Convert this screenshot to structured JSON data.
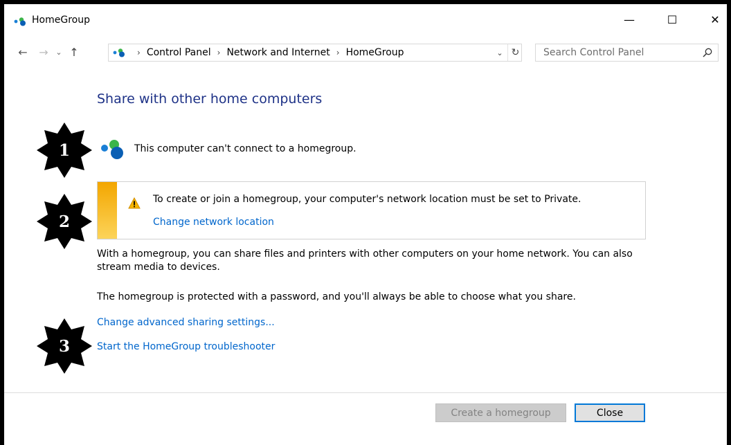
{
  "window": {
    "title": "HomeGroup",
    "title_icon": "homegroup-icon",
    "caption_buttons": {
      "minimize": "—",
      "maximize": "☐",
      "close": "✕"
    }
  },
  "nav": {
    "back": "←",
    "forward": "→",
    "recent": "⌄",
    "up": "↑"
  },
  "address": {
    "crumbs": [
      "Control Panel",
      "Network and Internet",
      "HomeGroup"
    ],
    "separator": "›",
    "dropdown": "⌄",
    "refresh": "↻"
  },
  "search": {
    "placeholder": "Search Control Panel",
    "icon": "search-icon"
  },
  "content": {
    "title": "Share with other home computers",
    "status": "This computer can't connect to a homegroup.",
    "warning": {
      "text": "To create or join a homegroup, your computer's network location must be set to Private.",
      "link": "Change network location",
      "icon": "warning-icon"
    },
    "para1": "With a homegroup, you can share files and printers with other computers on your home network. You can also stream media to devices.",
    "para2": "The homegroup is protected with a password, and you'll always be able to choose what you share.",
    "links": [
      "Change advanced sharing settings...",
      "Start the HomeGroup troubleshooter"
    ]
  },
  "buttons": {
    "create": "Create a homegroup",
    "close": "Close"
  },
  "annotations": [
    "1",
    "2",
    "3"
  ],
  "colors": {
    "title_blue": "#1e3287",
    "link_blue": "#0066cc",
    "warning_stripe": "#f3a600",
    "focus_border": "#0078d7"
  }
}
